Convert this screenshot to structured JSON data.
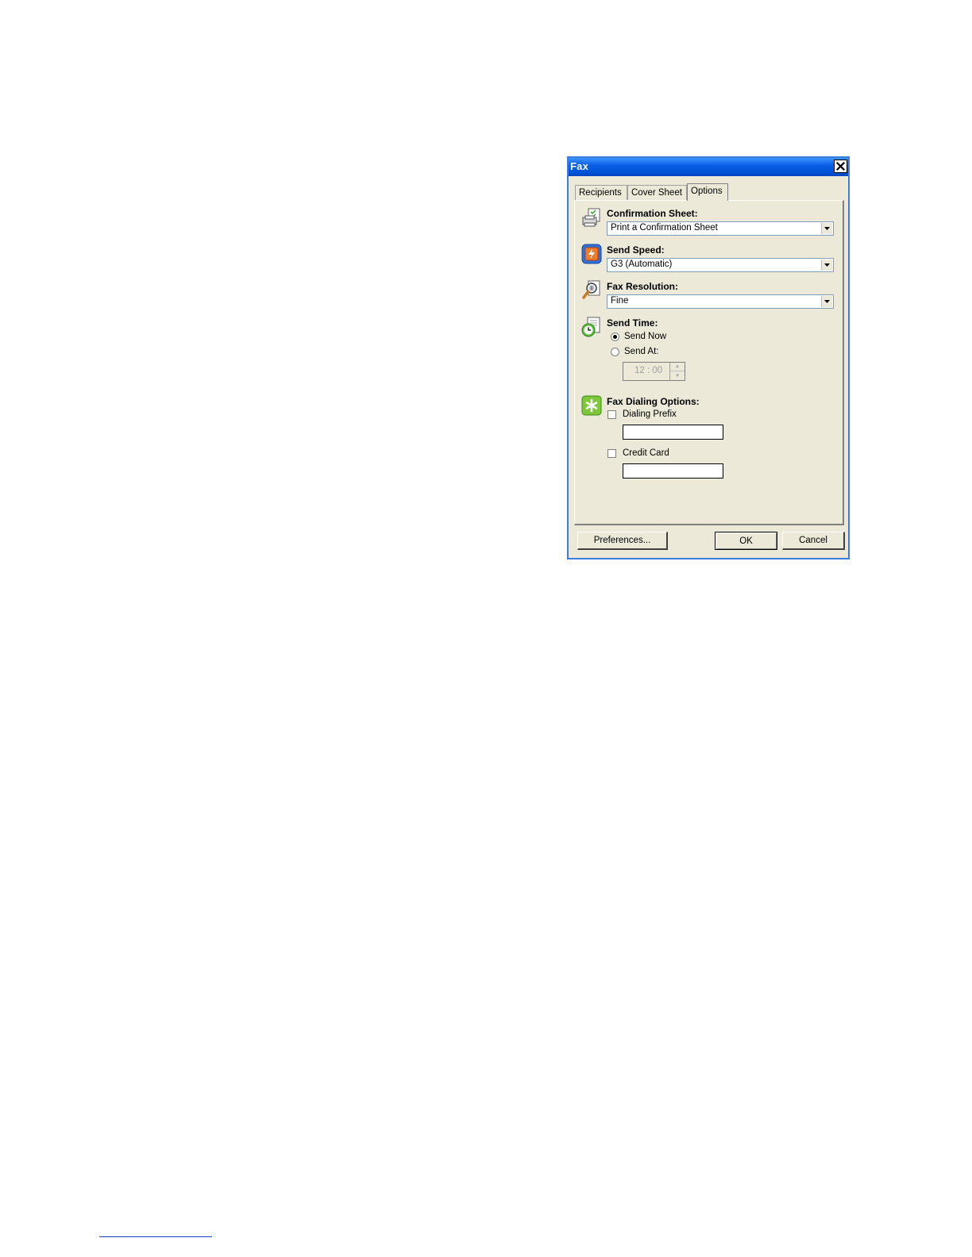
{
  "window": {
    "title": "Fax"
  },
  "tabs": [
    {
      "label": "Recipients",
      "active": false
    },
    {
      "label": "Cover Sheet",
      "active": false
    },
    {
      "label": "Options",
      "active": true
    }
  ],
  "confirmation_sheet": {
    "label": "Confirmation Sheet:",
    "value": "Print a Confirmation Sheet",
    "icon": "printer-confirmation-icon"
  },
  "send_speed": {
    "label": "Send Speed:",
    "value": "G3 (Automatic)",
    "icon": "send-speed-icon"
  },
  "fax_resolution": {
    "label": "Fax Resolution:",
    "value": "Fine",
    "icon": "magnifier-resolution-icon"
  },
  "send_time": {
    "label": "Send Time:",
    "icon": "clock-icon",
    "options": [
      {
        "label": "Send Now",
        "selected": true
      },
      {
        "label": "Send At:",
        "selected": false
      }
    ],
    "time_value": "12 : 00"
  },
  "dialing_options": {
    "label": "Fax Dialing Options:",
    "icon": "asterisk-icon",
    "dialing_prefix": {
      "label": "Dialing Prefix",
      "checked": false,
      "value": ""
    },
    "credit_card": {
      "label": "Credit Card",
      "checked": false,
      "value": ""
    }
  },
  "buttons": {
    "preferences": "Preferences...",
    "ok": "OK",
    "cancel": "Cancel"
  },
  "colors": {
    "titlebar": "#0052d6",
    "dialog_bg": "#ece9d8",
    "input_border": "#7f9db9"
  }
}
